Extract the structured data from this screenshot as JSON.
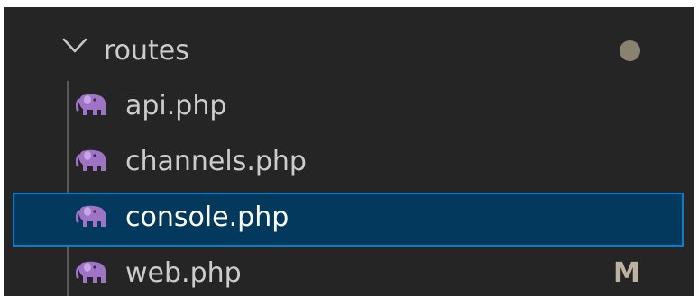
{
  "explorer": {
    "folder": {
      "name": "routes",
      "expanded": true,
      "modified_indicator_color": "#8b8170"
    },
    "files": [
      {
        "name": "api.php",
        "icon": "php-elephant-icon",
        "selected": false,
        "git_status": ""
      },
      {
        "name": "channels.php",
        "icon": "php-elephant-icon",
        "selected": false,
        "git_status": ""
      },
      {
        "name": "console.php",
        "icon": "php-elephant-icon",
        "selected": true,
        "git_status": ""
      },
      {
        "name": "web.php",
        "icon": "php-elephant-icon",
        "selected": false,
        "git_status": "M"
      }
    ],
    "colors": {
      "background": "#252526",
      "selection_background": "#04395e",
      "selection_border": "#007fd4",
      "php_icon": "#a074c4",
      "modified_text": "#bdb29f"
    }
  }
}
